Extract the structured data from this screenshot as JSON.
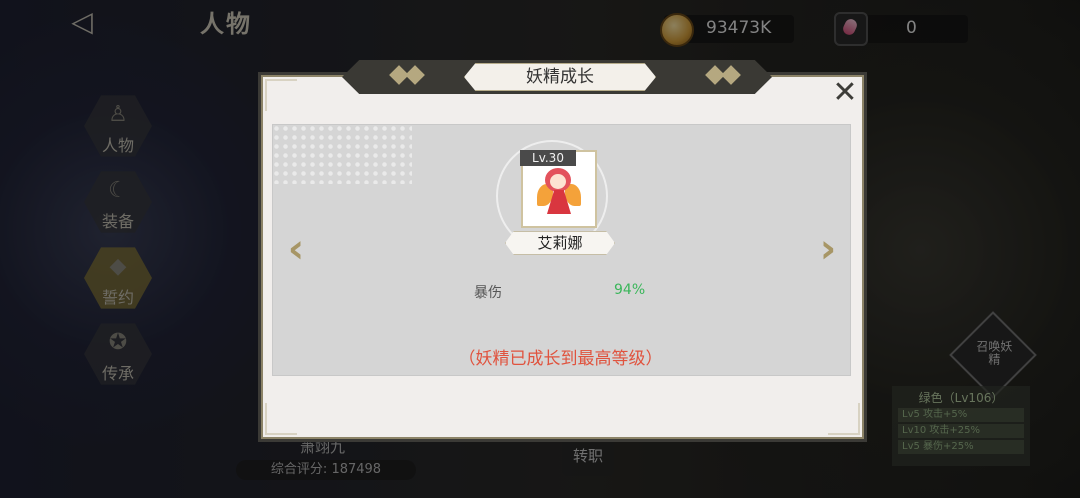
{
  "header": {
    "page_title": "人物",
    "back_icon": "back-arrow-icon",
    "gold": {
      "icon": "coin-icon",
      "value": "93473K"
    },
    "gems": {
      "icon": "gem-icon",
      "value": "0"
    }
  },
  "side_nav": {
    "items": [
      {
        "label": "人物",
        "icon": "person-icon",
        "active": false
      },
      {
        "label": "装备",
        "icon": "equipment-icon",
        "active": false
      },
      {
        "label": "誓约",
        "icon": "crystal-icon",
        "active": true
      },
      {
        "label": "传承",
        "icon": "inherit-icon",
        "active": false
      }
    ]
  },
  "background": {
    "character_name": "萧翊九",
    "score_label": "综合评分:",
    "score_value": "187498",
    "transfer_label": "转职",
    "fairy_badge_label": "召唤妖精",
    "green_panel": {
      "title": "绿色（Lv106）",
      "rows": [
        "Lv5  攻击+5%",
        "Lv10 攻击+25%",
        "Lv5  暴伤+25%"
      ]
    }
  },
  "modal": {
    "title": "妖精成长",
    "close_icon": "close-x-icon",
    "fairy": {
      "level": "Lv.30",
      "name": "艾莉娜"
    },
    "stat": {
      "label": "暴伤",
      "value": "94%"
    },
    "max_message": "（妖精已成长到最高等级）",
    "colors": {
      "accent": "#e0533e",
      "stat_green": "#3ab65a",
      "frame": "#3b3a36"
    }
  }
}
